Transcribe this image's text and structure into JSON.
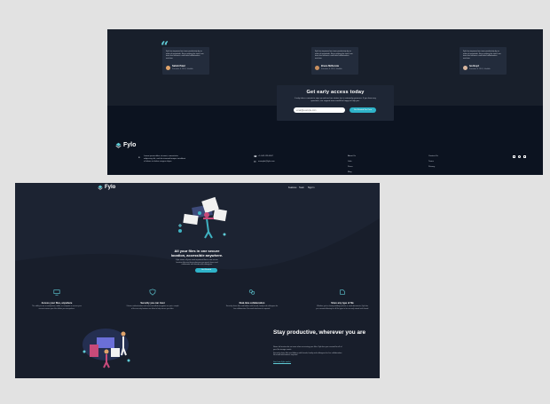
{
  "top_screenshot": {
    "testimonials": [
      {
        "text": "Fylo has improved our team productivity by an order of magnitude. Since making the switch our team has become a well-oiled collaboration machine.",
        "name": "Satish Patel",
        "role": "Founder & CEO, Huddle",
        "avatar_color": "#e0a36a"
      },
      {
        "text": "Fylo has improved our team productivity by an order of magnitude. Since making the switch our team has become a well-oiled collaboration machine.",
        "name": "Bruce McKenzie",
        "role": "Founder & CEO, Huddle",
        "avatar_color": "#c98f5e"
      },
      {
        "text": "Fylo has improved our team productivity by an order of magnitude. Since making the switch our team has become a well-oiled collaboration machine.",
        "name": "Iva Boyd",
        "role": "Founder & CEO, Huddle",
        "avatar_color": "#d9b7a0"
      }
    ],
    "cta": {
      "title": "Get early access today",
      "body": "It only takes a minute to sign up and our free starter tier is extremely generous. If you have any questions, our support team would be happy to help you.",
      "email_placeholder": "email@example.com",
      "button": "Get Started For Free"
    },
    "footer": {
      "brand": "Fylo",
      "address": "Lorem ipsum dolor sit amet, consectetur adipiscing elit, sed do eiusmod tempor incididunt ut labore et dolore magna aliqua",
      "phone": "+1-543-123-4567",
      "email": "example@fylo.com",
      "col1": [
        "About Us",
        "Jobs",
        "Press",
        "Blog"
      ],
      "col2": [
        "Contact Us",
        "Terms",
        "Privacy"
      ]
    }
  },
  "bottom_screenshot": {
    "brand": "Fylo",
    "nav": [
      "Features",
      "Team",
      "Sign In"
    ],
    "hero": {
      "title": "All your files in one secure location, accessible anywhere.",
      "body": "Fylo stores all your most important files in one secure location. Access them wherever you need, share and collaborate with friends and colleagues.",
      "button": "Get Started"
    },
    "features": [
      {
        "title": "Access your files, anywhere",
        "body": "The ability to use a smartphone, tablet, or computer to access your account means your files follow you everywhere."
      },
      {
        "title": "Security you can trust",
        "body": "2-factor authentication and user-controlled encryption are just a couple of the security features we allow to help secure your files."
      },
      {
        "title": "Real-time collaboration",
        "body": "Securely share files and folders with friends, family and colleagues for live collaboration. No email attachments required."
      },
      {
        "title": "Store any type of file",
        "body": "Whether you're sharing holidays photos or work documents, Fylo has you covered allowing for all file types to be securely stored and shared."
      }
    ],
    "productive": {
      "title": "Stay productive, wherever you are",
      "body1": "Never let location be an issue when accessing your files. Fylo has you covered for all of your file storage needs.",
      "body2": "Securely share files and folders with friends, family and colleagues for live collaboration. No email attachments required.",
      "link": "See how Fylo works"
    }
  },
  "colors": {
    "accent": "#2fb3c9",
    "dark": "#0c1320",
    "card": "#232c3c"
  }
}
